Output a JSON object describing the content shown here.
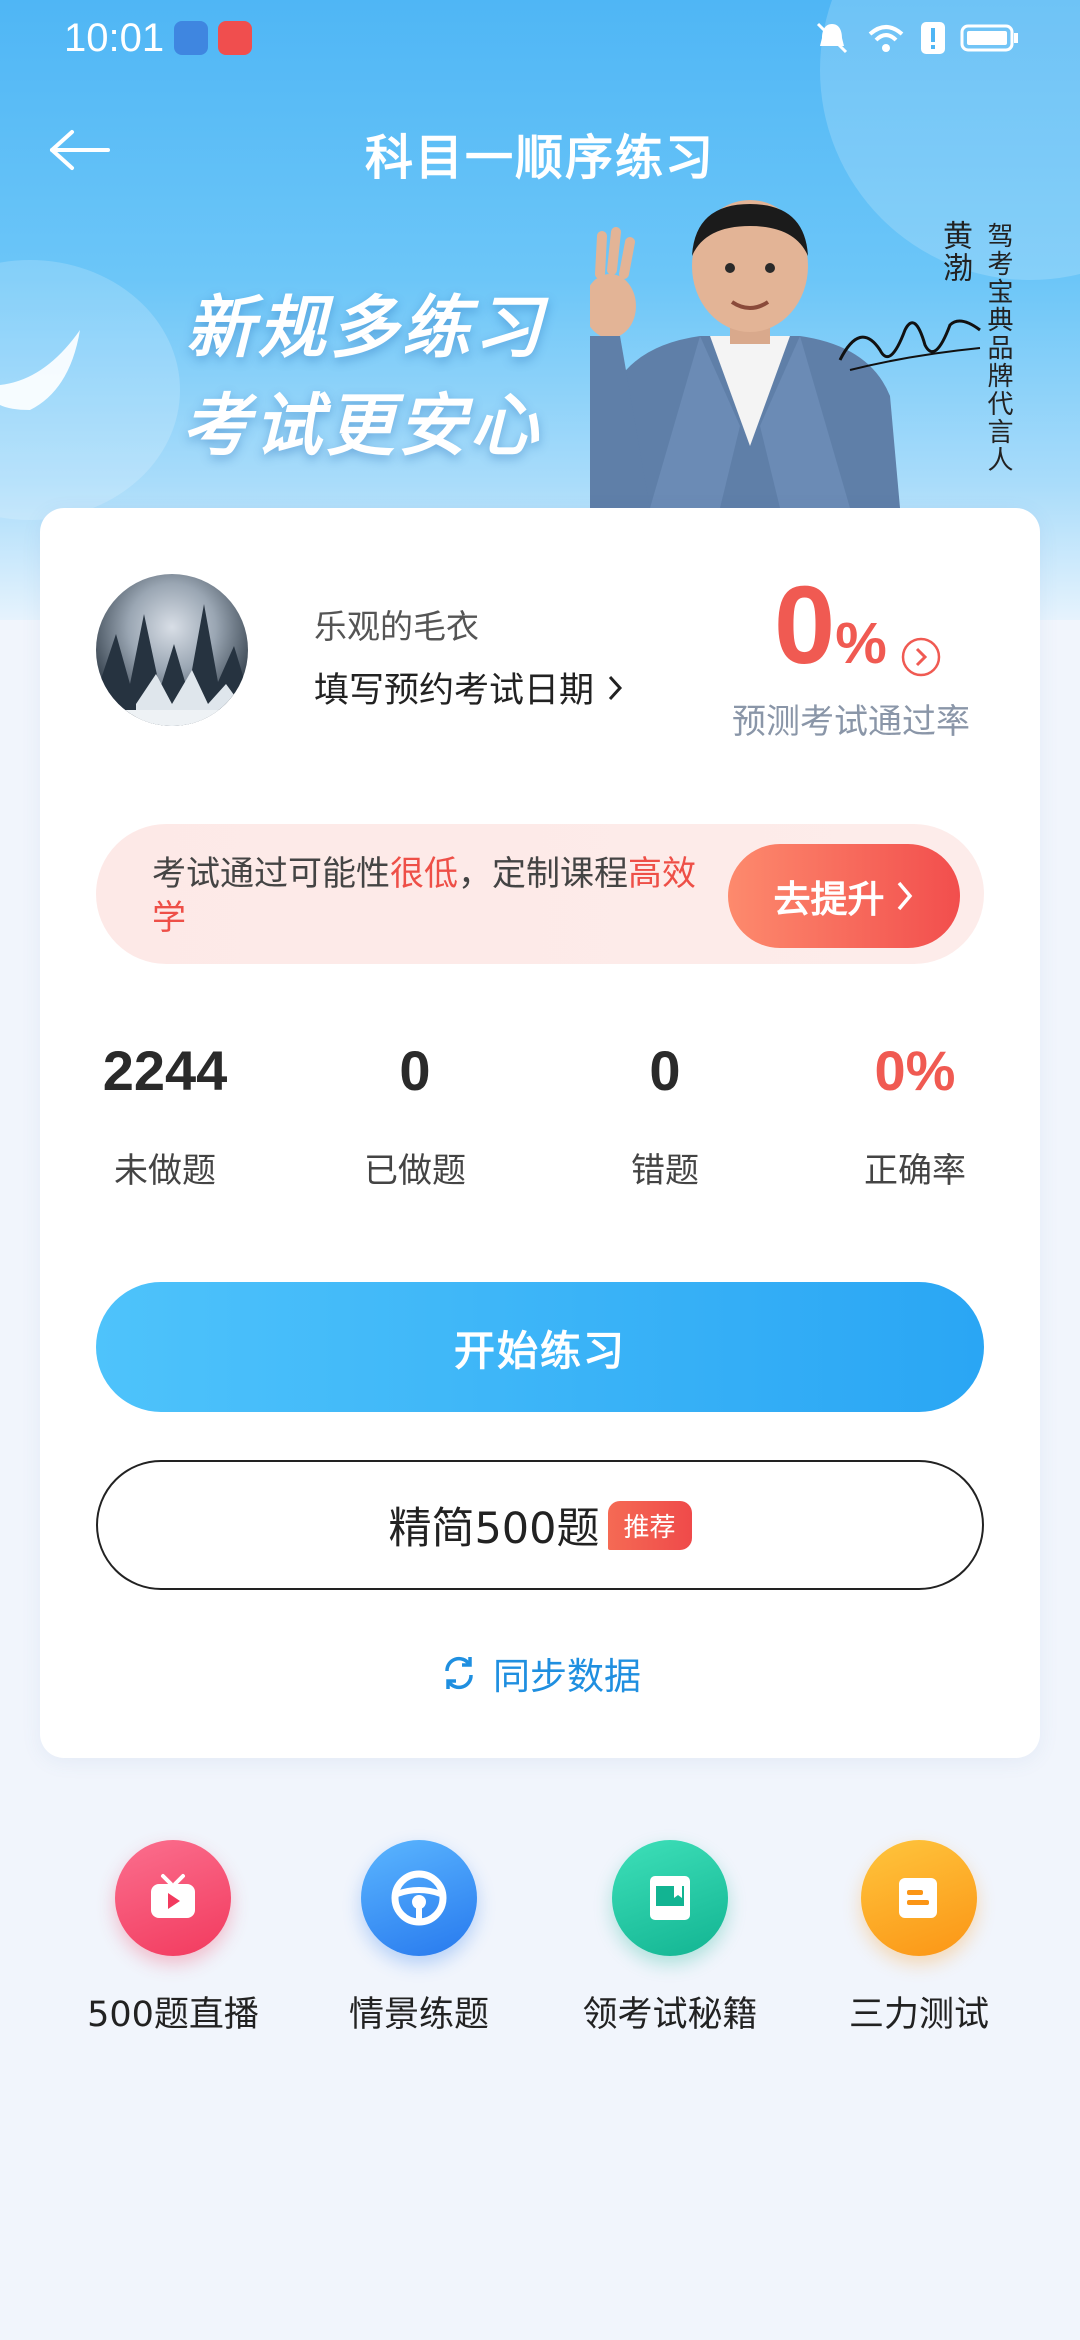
{
  "status_bar": {
    "time": "10:01"
  },
  "header": {
    "title": "科目一顺序练习"
  },
  "banner": {
    "slogan_line1": "新规多练习",
    "slogan_line2": "考试更安心",
    "endorser_name": "黄渤",
    "endorser_title": "驾考宝典品牌代言人"
  },
  "profile": {
    "username": "乐观的毛衣",
    "exam_date_prompt": "填写预约考试日期",
    "pass_rate_value": "0",
    "pass_rate_unit": "%",
    "pass_rate_label": "预测考试通过率"
  },
  "tip": {
    "text_part1": "考试通过可能性",
    "text_highlight1": "很低",
    "text_part2": "，定制课程",
    "text_highlight2": "高效学",
    "button_label": "去提升"
  },
  "stats": [
    {
      "value": "2244",
      "label": "未做题"
    },
    {
      "value": "0",
      "label": "已做题"
    },
    {
      "value": "0",
      "label": "错题"
    },
    {
      "value": "0%",
      "label": "正确率"
    }
  ],
  "actions": {
    "start_label": "开始练习",
    "selected_label": "精简500题",
    "selected_badge": "推荐",
    "sync_label": "同步数据"
  },
  "tools": [
    {
      "label": "500题直播",
      "icon": "tv-play-icon",
      "color": "#f4466b"
    },
    {
      "label": "情景练题",
      "icon": "steering-wheel-icon",
      "color": "#2d8ff4"
    },
    {
      "label": "领考试秘籍",
      "icon": "book-icon",
      "color": "#1fc3a0"
    },
    {
      "label": "三力测试",
      "icon": "document-icon",
      "color": "#fba21d"
    }
  ],
  "colors": {
    "accent_blue": "#2aa6f4",
    "accent_red": "#f05a52"
  }
}
